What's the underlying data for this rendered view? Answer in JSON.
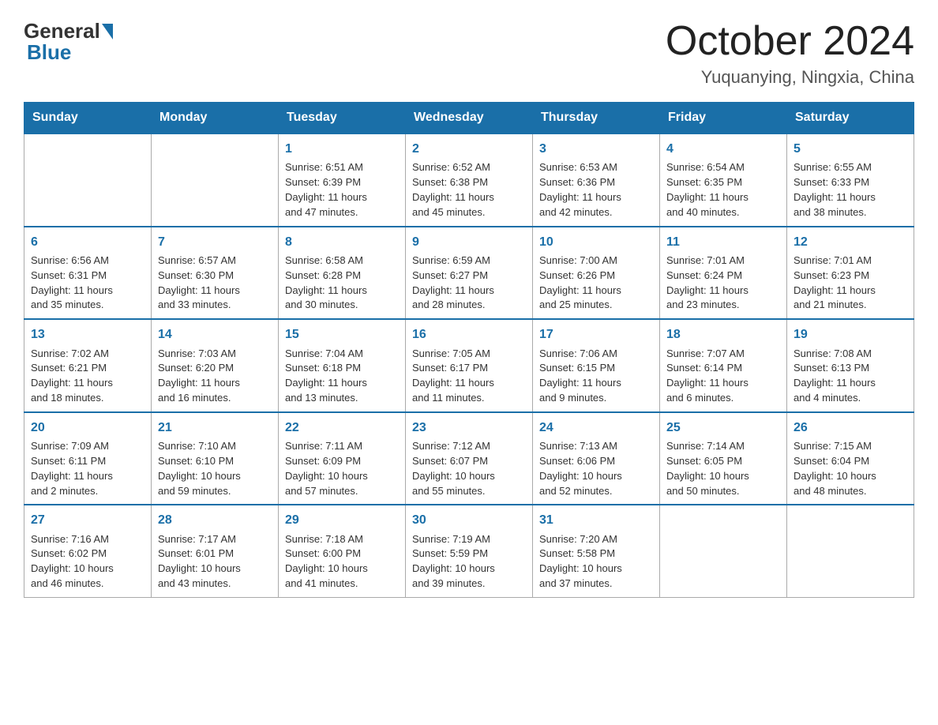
{
  "header": {
    "logo_general": "General",
    "logo_blue": "Blue",
    "month_title": "October 2024",
    "location": "Yuquanying, Ningxia, China"
  },
  "days_of_week": [
    "Sunday",
    "Monday",
    "Tuesday",
    "Wednesday",
    "Thursday",
    "Friday",
    "Saturday"
  ],
  "weeks": [
    [
      {
        "day": "",
        "info": ""
      },
      {
        "day": "",
        "info": ""
      },
      {
        "day": "1",
        "info": "Sunrise: 6:51 AM\nSunset: 6:39 PM\nDaylight: 11 hours\nand 47 minutes."
      },
      {
        "day": "2",
        "info": "Sunrise: 6:52 AM\nSunset: 6:38 PM\nDaylight: 11 hours\nand 45 minutes."
      },
      {
        "day": "3",
        "info": "Sunrise: 6:53 AM\nSunset: 6:36 PM\nDaylight: 11 hours\nand 42 minutes."
      },
      {
        "day": "4",
        "info": "Sunrise: 6:54 AM\nSunset: 6:35 PM\nDaylight: 11 hours\nand 40 minutes."
      },
      {
        "day": "5",
        "info": "Sunrise: 6:55 AM\nSunset: 6:33 PM\nDaylight: 11 hours\nand 38 minutes."
      }
    ],
    [
      {
        "day": "6",
        "info": "Sunrise: 6:56 AM\nSunset: 6:31 PM\nDaylight: 11 hours\nand 35 minutes."
      },
      {
        "day": "7",
        "info": "Sunrise: 6:57 AM\nSunset: 6:30 PM\nDaylight: 11 hours\nand 33 minutes."
      },
      {
        "day": "8",
        "info": "Sunrise: 6:58 AM\nSunset: 6:28 PM\nDaylight: 11 hours\nand 30 minutes."
      },
      {
        "day": "9",
        "info": "Sunrise: 6:59 AM\nSunset: 6:27 PM\nDaylight: 11 hours\nand 28 minutes."
      },
      {
        "day": "10",
        "info": "Sunrise: 7:00 AM\nSunset: 6:26 PM\nDaylight: 11 hours\nand 25 minutes."
      },
      {
        "day": "11",
        "info": "Sunrise: 7:01 AM\nSunset: 6:24 PM\nDaylight: 11 hours\nand 23 minutes."
      },
      {
        "day": "12",
        "info": "Sunrise: 7:01 AM\nSunset: 6:23 PM\nDaylight: 11 hours\nand 21 minutes."
      }
    ],
    [
      {
        "day": "13",
        "info": "Sunrise: 7:02 AM\nSunset: 6:21 PM\nDaylight: 11 hours\nand 18 minutes."
      },
      {
        "day": "14",
        "info": "Sunrise: 7:03 AM\nSunset: 6:20 PM\nDaylight: 11 hours\nand 16 minutes."
      },
      {
        "day": "15",
        "info": "Sunrise: 7:04 AM\nSunset: 6:18 PM\nDaylight: 11 hours\nand 13 minutes."
      },
      {
        "day": "16",
        "info": "Sunrise: 7:05 AM\nSunset: 6:17 PM\nDaylight: 11 hours\nand 11 minutes."
      },
      {
        "day": "17",
        "info": "Sunrise: 7:06 AM\nSunset: 6:15 PM\nDaylight: 11 hours\nand 9 minutes."
      },
      {
        "day": "18",
        "info": "Sunrise: 7:07 AM\nSunset: 6:14 PM\nDaylight: 11 hours\nand 6 minutes."
      },
      {
        "day": "19",
        "info": "Sunrise: 7:08 AM\nSunset: 6:13 PM\nDaylight: 11 hours\nand 4 minutes."
      }
    ],
    [
      {
        "day": "20",
        "info": "Sunrise: 7:09 AM\nSunset: 6:11 PM\nDaylight: 11 hours\nand 2 minutes."
      },
      {
        "day": "21",
        "info": "Sunrise: 7:10 AM\nSunset: 6:10 PM\nDaylight: 10 hours\nand 59 minutes."
      },
      {
        "day": "22",
        "info": "Sunrise: 7:11 AM\nSunset: 6:09 PM\nDaylight: 10 hours\nand 57 minutes."
      },
      {
        "day": "23",
        "info": "Sunrise: 7:12 AM\nSunset: 6:07 PM\nDaylight: 10 hours\nand 55 minutes."
      },
      {
        "day": "24",
        "info": "Sunrise: 7:13 AM\nSunset: 6:06 PM\nDaylight: 10 hours\nand 52 minutes."
      },
      {
        "day": "25",
        "info": "Sunrise: 7:14 AM\nSunset: 6:05 PM\nDaylight: 10 hours\nand 50 minutes."
      },
      {
        "day": "26",
        "info": "Sunrise: 7:15 AM\nSunset: 6:04 PM\nDaylight: 10 hours\nand 48 minutes."
      }
    ],
    [
      {
        "day": "27",
        "info": "Sunrise: 7:16 AM\nSunset: 6:02 PM\nDaylight: 10 hours\nand 46 minutes."
      },
      {
        "day": "28",
        "info": "Sunrise: 7:17 AM\nSunset: 6:01 PM\nDaylight: 10 hours\nand 43 minutes."
      },
      {
        "day": "29",
        "info": "Sunrise: 7:18 AM\nSunset: 6:00 PM\nDaylight: 10 hours\nand 41 minutes."
      },
      {
        "day": "30",
        "info": "Sunrise: 7:19 AM\nSunset: 5:59 PM\nDaylight: 10 hours\nand 39 minutes."
      },
      {
        "day": "31",
        "info": "Sunrise: 7:20 AM\nSunset: 5:58 PM\nDaylight: 10 hours\nand 37 minutes."
      },
      {
        "day": "",
        "info": ""
      },
      {
        "day": "",
        "info": ""
      }
    ]
  ]
}
